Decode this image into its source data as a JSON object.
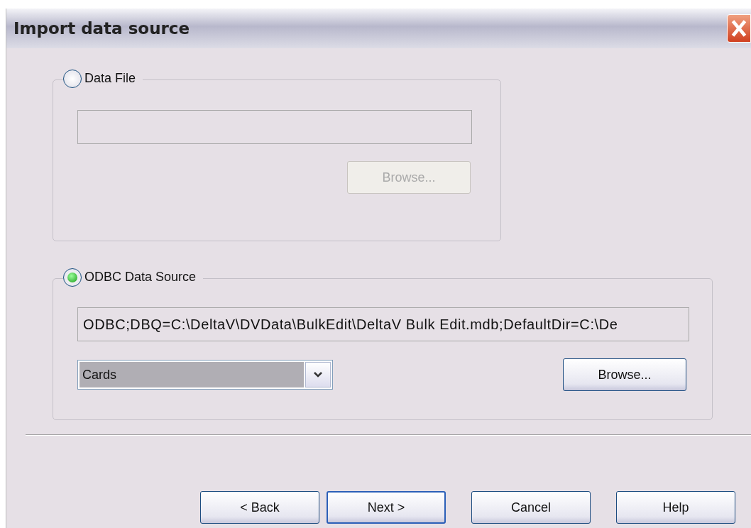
{
  "window": {
    "title": "Import data source"
  },
  "sources": [
    {
      "label": "Data File",
      "selected": false,
      "browse": {
        "label": "Browse...",
        "disabled": true
      }
    },
    {
      "label": "ODBC Data Source",
      "selected": true,
      "field": {
        "value": "ODBC;DBQ=C:\\DeltaV\\DVData\\BulkEdit\\DeltaV Bulk Edit.mdb;DefaultDir=C:\\De"
      },
      "table_select": {
        "value": "Cards"
      },
      "browse": {
        "label": "Browse...",
        "disabled": false
      }
    }
  ],
  "buttons": [
    {
      "label": "< Back",
      "default": false
    },
    {
      "label": "Next >",
      "default": true
    },
    {
      "label": "Cancel",
      "default": false
    },
    {
      "label": "Help",
      "default": false
    }
  ]
}
